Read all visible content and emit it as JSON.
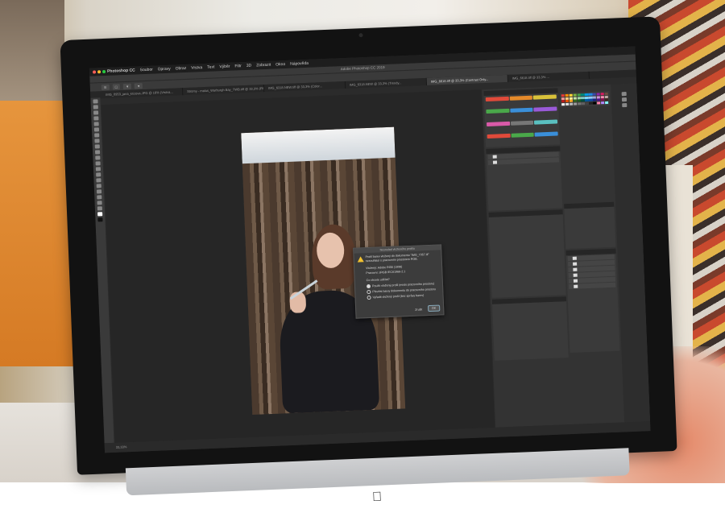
{
  "app": {
    "name": "Photoshop CC",
    "window_title": "Adobe Photoshop CC 2019",
    "menu": [
      "Soubor",
      "Úpravy",
      "Obraz",
      "Vrstva",
      "Text",
      "Výběr",
      "Filtr",
      "3D",
      "Zobrazit",
      "Okno",
      "Nápověda"
    ]
  },
  "tabs": [
    "IMG_0953_jana_krizova.JPG @ 16% (Vrstva...",
    "Stromy - malus_Warburgh Bay_TWB.tiff @ 33,3% (RGB/8)...",
    "IMG_6318.NEW.tiff @ 33,3% (Color...",
    "IMG_6318.NEW @ 33,3% (Trendy...",
    "IMG_6618.tiff @ 33,3% (Contrast Only...",
    "IMG_6618.tiff @ 33,3% ..."
  ],
  "dialog": {
    "title": "Nesoulad vloženého profilu",
    "message": "Profil barev vložený do dokumentu \"IMG_7357.tif\" nesouhlasí s pracovním prostorem RGB.",
    "embedded": "Vložený: Adobe RGB (1998)",
    "working": "Pracovní: sRGB IEC61966-2.1",
    "question": "Co chcete udělat?",
    "options": [
      "Použít vložený profil (místo pracovního prostoru)",
      "Převést barvy dokumentu do pracovního prostoru",
      "Vyřadit vložený profil (bez správy barev)"
    ],
    "cancel_label": "Zrušit",
    "ok_label": "OK"
  },
  "status": {
    "zoom": "33,33%"
  },
  "colors": {
    "tags": [
      "#e04a3a",
      "#e58a2a",
      "#d9c23a",
      "#4aa84a",
      "#3a8fd9",
      "#9a5ad9",
      "#d95aa8",
      "#777777",
      "#5ac0c0"
    ]
  }
}
